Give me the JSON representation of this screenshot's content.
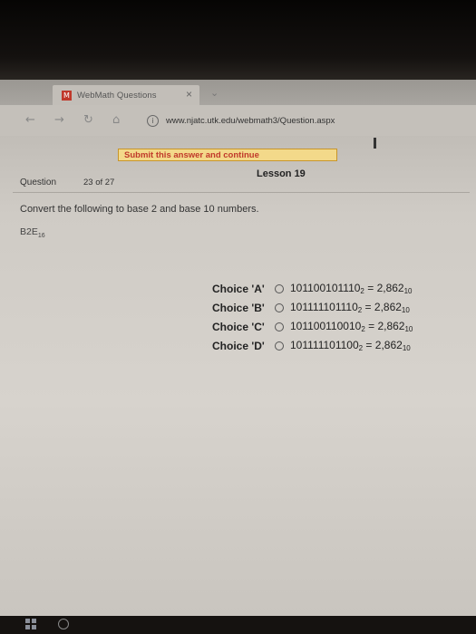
{
  "browser": {
    "tab_title": "WebMath Questions",
    "tab_close": "×",
    "new_tab": "⌄",
    "favicon": "M",
    "url": "www.njatc.utk.edu/webmath3/Question.aspx",
    "back": "←",
    "forward": "→",
    "refresh": "↻",
    "home": "⌂"
  },
  "page": {
    "submit_label": "Submit this answer and continue",
    "question_label": "Question",
    "question_count": "23 of 27",
    "lesson": "Lesson 19",
    "instructions": "Convert the following to base 2 and base 10 numbers.",
    "problem_code": "B2E",
    "problem_code_base": "16"
  },
  "choices": [
    {
      "label": "Choice 'A'",
      "binary": "101100101110",
      "base2": "2",
      "decimal": "2,862",
      "base10": "10"
    },
    {
      "label": "Choice 'B'",
      "binary": "101111101110",
      "base2": "2",
      "decimal": "2,862",
      "base10": "10"
    },
    {
      "label": "Choice 'C'",
      "binary": "101100110010",
      "base2": "2",
      "decimal": "2,862",
      "base10": "10"
    },
    {
      "label": "Choice 'D'",
      "binary": "101111101100",
      "base2": "2",
      "decimal": "2,862",
      "base10": "10"
    }
  ],
  "colors": {
    "submit_bg": "#f3d98a",
    "submit_text": "#c0392b",
    "submit_border": "#c8952a"
  },
  "icons": [
    "favicon-icon",
    "close-icon",
    "back-arrow-icon",
    "forward-arrow-icon",
    "refresh-icon",
    "home-icon",
    "info-icon",
    "radio-icon",
    "windows-start-icon",
    "search-icon"
  ]
}
